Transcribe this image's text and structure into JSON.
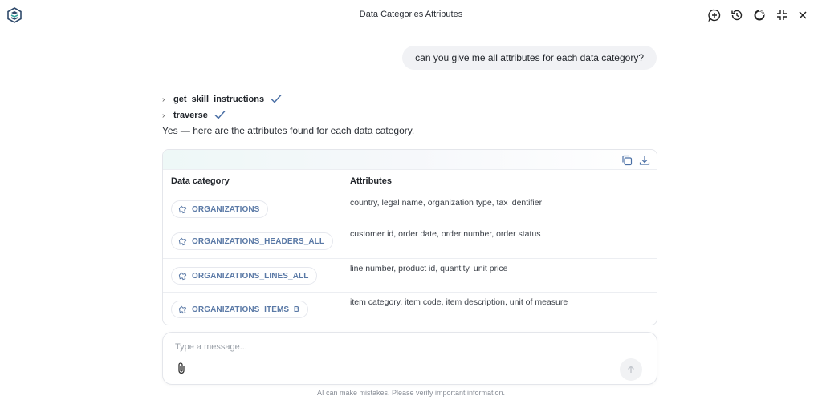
{
  "header": {
    "title": "Data Categories Attributes",
    "icons": [
      "app-logo-icon",
      "new-chat-icon",
      "history-icon",
      "loading-circle-icon",
      "collapse-icon",
      "close-icon"
    ]
  },
  "conversation": {
    "user_message": "can you give me all attributes for each data category?",
    "tool_calls": [
      {
        "name": "get_skill_instructions",
        "status": "done"
      },
      {
        "name": "traverse",
        "status": "done"
      }
    ],
    "answer": "Yes — here are the attributes found for each data category."
  },
  "table": {
    "columns": [
      "Data category",
      "Attributes"
    ],
    "rows": [
      {
        "category": "ORGANIZATIONS",
        "attributes": "country, legal name, organization type, tax identifier"
      },
      {
        "category": "ORGANIZATIONS_HEADERS_ALL",
        "attributes": "customer id, order date, order number, order status"
      },
      {
        "category": "ORGANIZATIONS_LINES_ALL",
        "attributes": "line number, product id, quantity, unit price"
      },
      {
        "category": "ORGANIZATIONS_ITEMS_B",
        "attributes": "item category, item code, item description, unit of measure"
      }
    ],
    "actions": [
      "copy-icon",
      "download-icon"
    ]
  },
  "composer": {
    "placeholder": "Type a message...",
    "value": ""
  },
  "disclaimer": "AI can make mistakes. Please verify important information.",
  "colors": {
    "chip_text": "#5a79a6",
    "check": "#4a6fa5",
    "bubble": "#f1f2f5"
  }
}
